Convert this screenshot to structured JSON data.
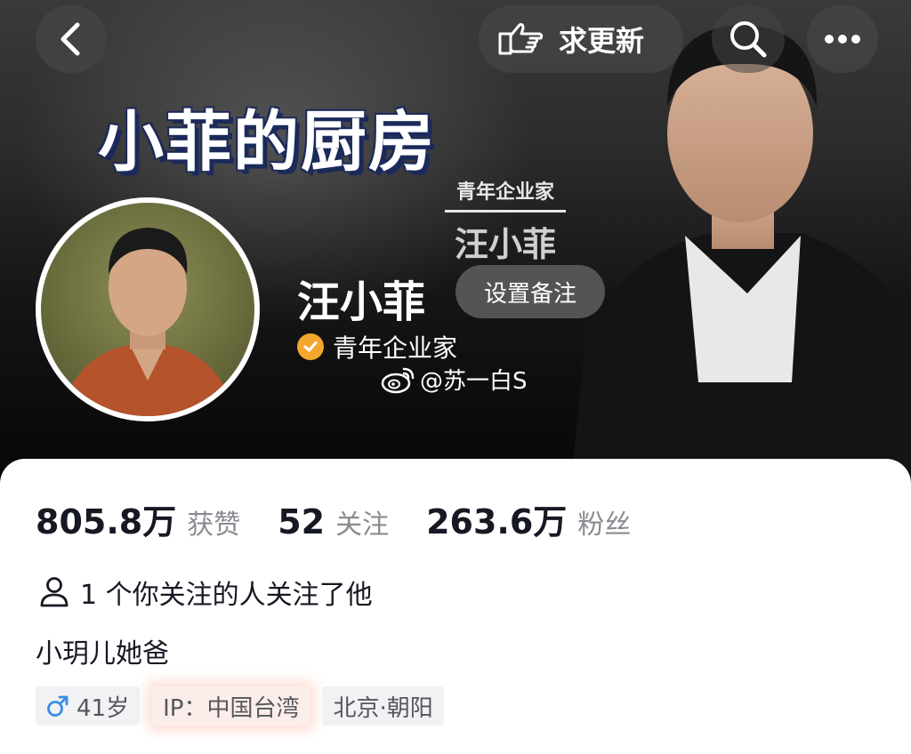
{
  "nav": {
    "update_label": "求更新"
  },
  "cover": {
    "title": "小菲的厨房",
    "subtitle": "青年企业家",
    "name": "汪小菲"
  },
  "profile": {
    "name": "汪小菲",
    "remark_button": "设置备注",
    "verification": "青年企业家",
    "watermark": "@苏一白S"
  },
  "stats": [
    {
      "value": "805.8万",
      "label": "获赞"
    },
    {
      "value": "52",
      "label": "关注"
    },
    {
      "value": "263.6万",
      "label": "粉丝"
    }
  ],
  "mutual": "1 个你关注的人关注了他",
  "bio": "小玥儿她爸",
  "tags": {
    "gender_icon": "male-symbol",
    "age": "41岁",
    "ip": "IP：中国台湾",
    "location": "北京·朝阳"
  },
  "colors": {
    "verify_badge": "#f3a72e",
    "gender_blue": "#3a8ee6",
    "ip_highlight": "#fbeeea"
  }
}
